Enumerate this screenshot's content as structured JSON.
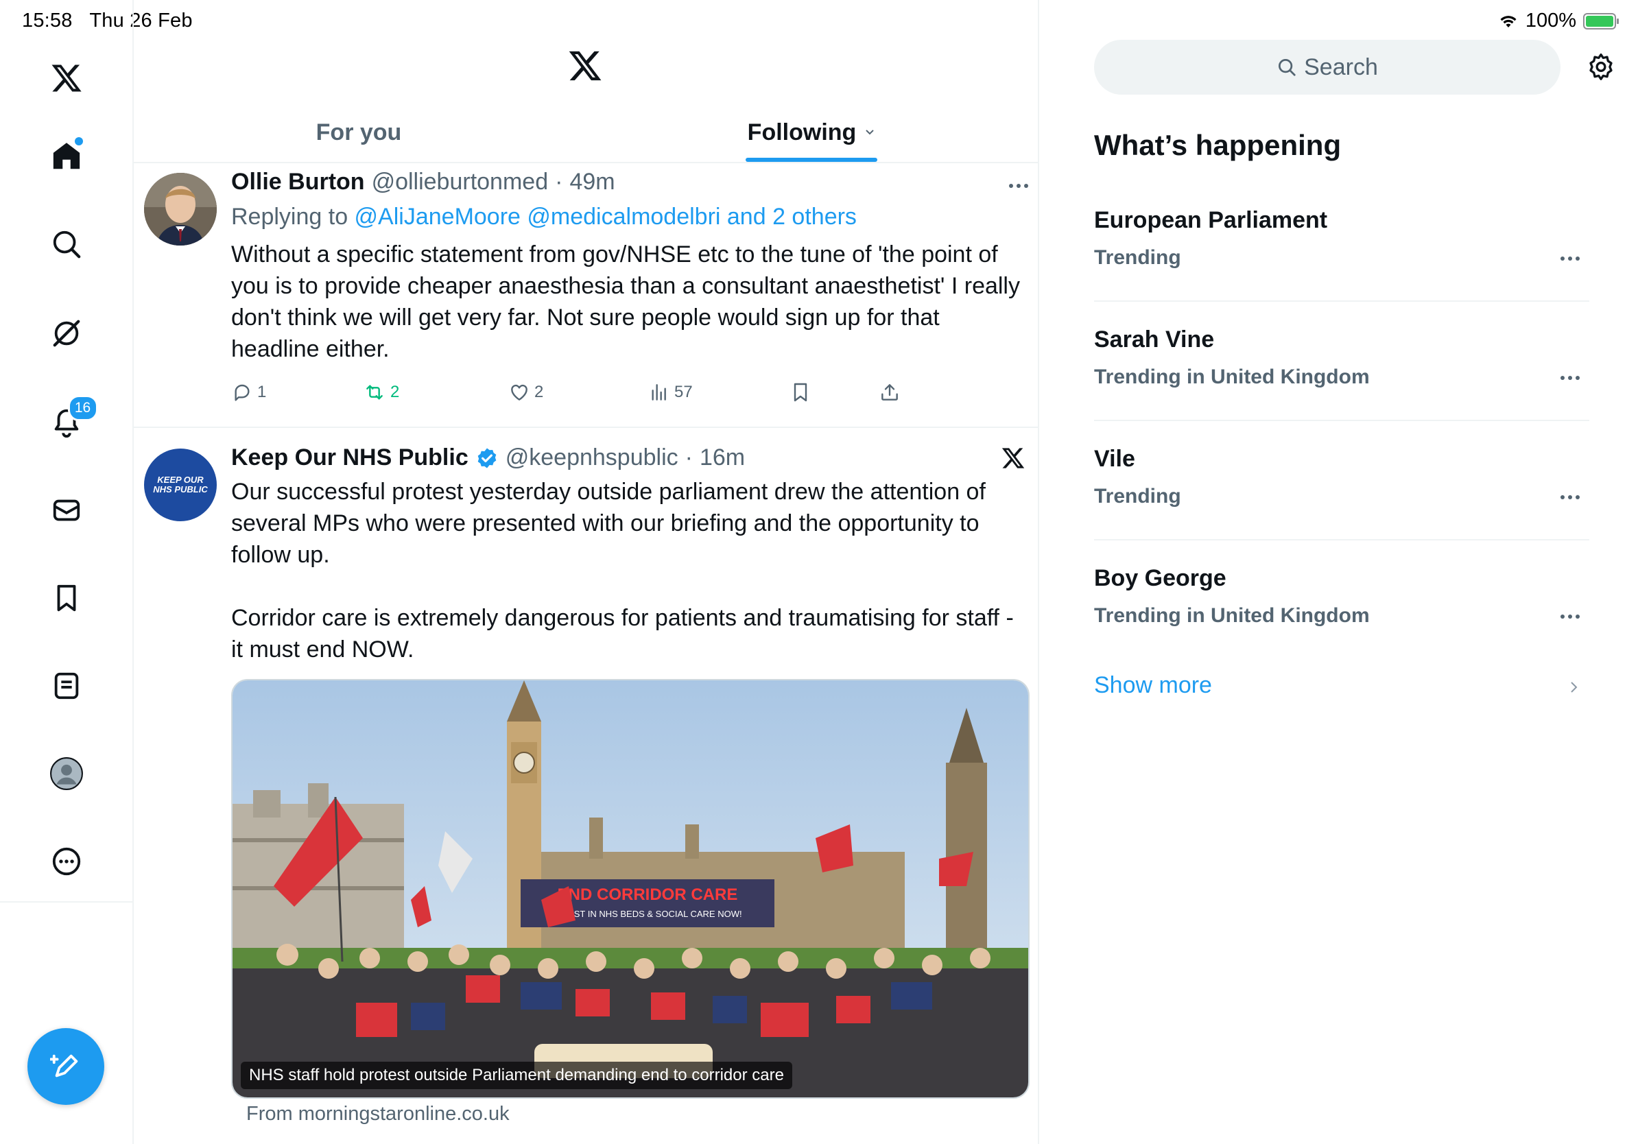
{
  "status_bar": {
    "time": "15:58",
    "date": "Thu 26 Feb",
    "battery": "100%",
    "battery_level": 1.0
  },
  "nav": {
    "items": [
      {
        "name": "home-icon"
      },
      {
        "name": "search-icon"
      },
      {
        "name": "grok-icon"
      },
      {
        "name": "notifications-icon",
        "badge": "16"
      },
      {
        "name": "messages-icon"
      },
      {
        "name": "bookmarks-icon"
      },
      {
        "name": "lists-icon"
      },
      {
        "name": "profile-icon"
      },
      {
        "name": "more-icon"
      }
    ],
    "compose": "compose-icon"
  },
  "header": {
    "tabs": [
      {
        "label": "For you",
        "active": false
      },
      {
        "label": "Following",
        "active": true
      }
    ]
  },
  "tweets": [
    {
      "name": "Ollie Burton",
      "handle": "@ollieburtonmed",
      "time": "49m",
      "replying_prefix": "Replying to ",
      "replying_to": "@AliJaneMoore @medicalmodelbri and 2 others",
      "text": "Without a specific statement from gov/NHSE etc to the tune of 'the point of you is to provide cheaper anaesthesia than a consultant anaesthetist' I really don't think we will get very far. Not sure people would sign up for that headline either.",
      "replies": "1",
      "reposts": "2",
      "likes": "2",
      "views": "57"
    },
    {
      "name": "Keep Our NHS Public",
      "handle": "@keepnhspublic",
      "time": "16m",
      "avatar_text": "KEEP OUR NHS PUBLIC",
      "text": "Our successful protest yesterday outside parliament drew the attention of several MPs who were presented with our briefing and the opportunity to follow up.\n\nCorridor care is extremely dangerous for patients and traumatising for staff - it must end NOW.",
      "media_caption": "NHS staff hold protest outside Parliament demanding end to corridor care",
      "media_banner": "END CORRIDOR CARE",
      "media_banner_sub": "INVEST IN NHS BEDS & SOCIAL CARE NOW!",
      "source": "From morningstaronline.co.uk"
    }
  ],
  "sidebar": {
    "search_placeholder": "Search",
    "title": "What’s happening",
    "trends": [
      {
        "topic": "European Parliament",
        "context": "Trending"
      },
      {
        "topic": "Sarah Vine",
        "context": "Trending in United Kingdom"
      },
      {
        "topic": "Vile",
        "context": "Trending"
      },
      {
        "topic": "Boy George",
        "context": "Trending in United Kingdom"
      }
    ],
    "show_more": "Show more"
  },
  "colors": {
    "accent": "#1d9bf0",
    "repost_green": "#00ba7c",
    "muted": "#536471"
  }
}
